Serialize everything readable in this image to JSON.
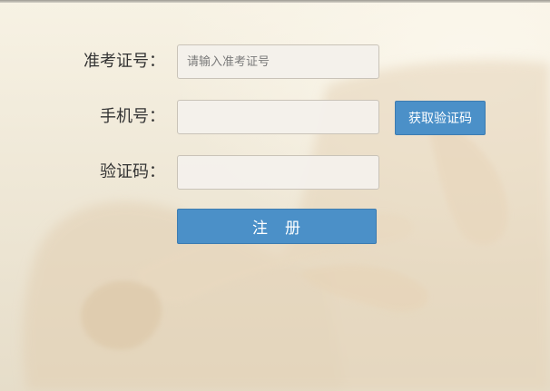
{
  "form": {
    "exam_id": {
      "label": "准考证号：",
      "value": "",
      "placeholder": "请输入准考证号"
    },
    "phone": {
      "label": "手机号：",
      "value": "",
      "placeholder": ""
    },
    "verify_code": {
      "label": "验证码：",
      "value": "",
      "placeholder": ""
    },
    "get_code_label": "获取验证码",
    "register_label": "注　册"
  },
  "colors": {
    "accent": "#4b90c8",
    "background": "#efe8d7"
  }
}
